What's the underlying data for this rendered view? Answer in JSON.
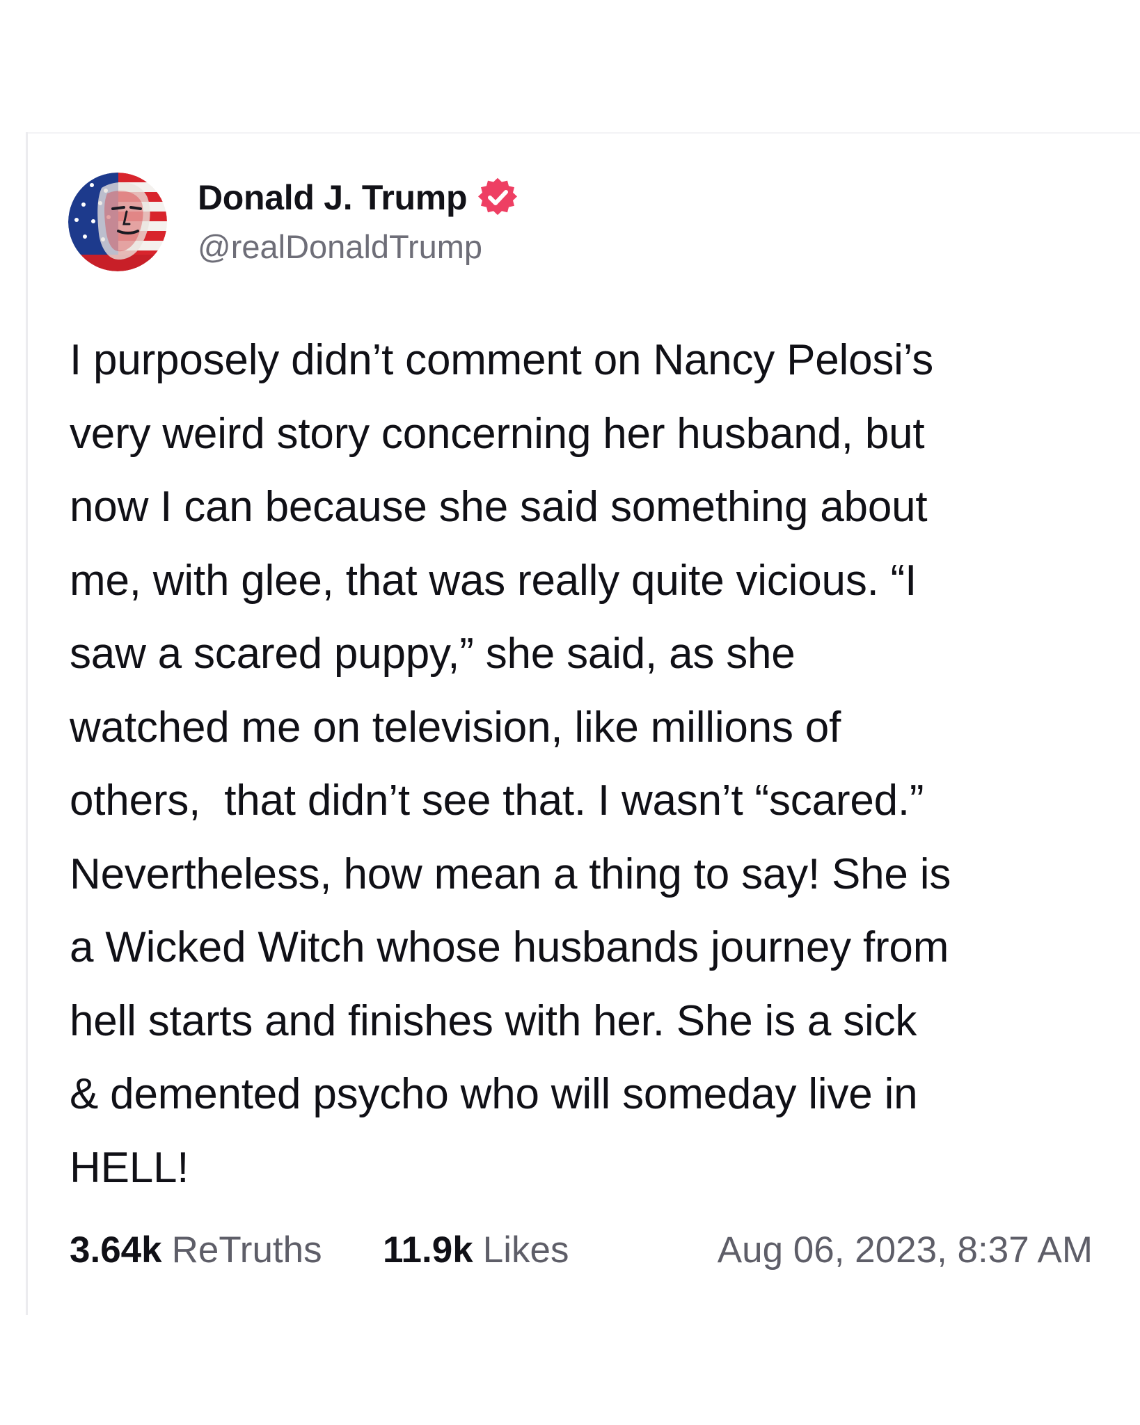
{
  "author": {
    "display_name": "Donald J. Trump",
    "handle": "@realDonaldTrump",
    "verified_icon": "verified-badge-icon",
    "verified_color": "#ee3f63",
    "avatar_icon": "profile-avatar-flag-portrait"
  },
  "post": {
    "lines": [
      "I purposely didn’t comment on Nancy Pelosi’s",
      "very weird story concerning her husband, but",
      "now I can because she said something about",
      "me, with glee, that was really quite vicious. “I",
      "saw a scared puppy,” she said, as she",
      "watched me on television, like millions of",
      "others,  that didn’t see that. I wasn’t “scared.”",
      "Nevertheless, how mean a thing to say! She is",
      "a Wicked Witch whose husbands journey from",
      "hell starts and finishes with her. She is a sick",
      "& demented psycho who will someday live in",
      "HELL!"
    ]
  },
  "stats": {
    "retruths_value": "3.64k",
    "retruths_label": "ReTruths",
    "likes_value": "11.9k",
    "likes_label": "Likes"
  },
  "timestamp": "Aug 06, 2023, 8:37 AM"
}
